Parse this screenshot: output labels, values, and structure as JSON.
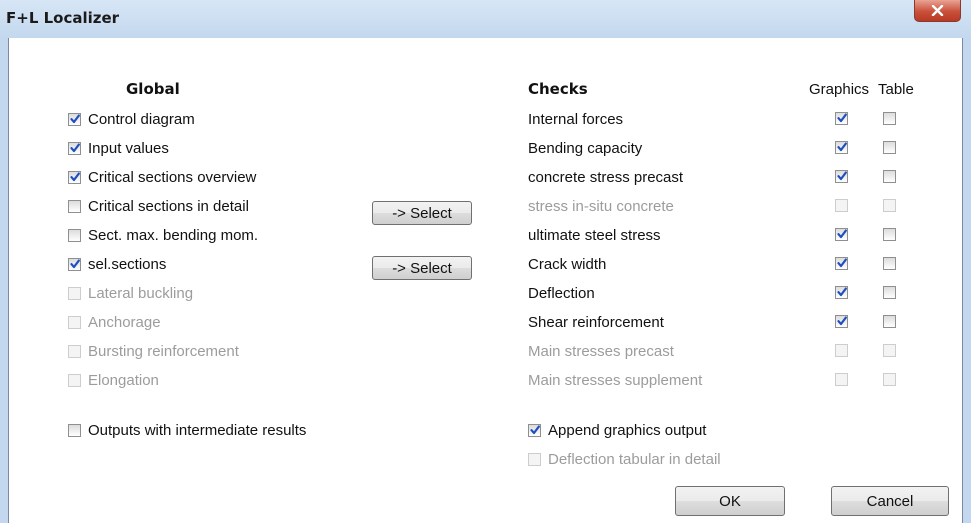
{
  "window": {
    "title": "F+L Localizer",
    "close_glyph": "close-icon"
  },
  "global": {
    "header": "Global",
    "items": [
      {
        "label": "Control diagram",
        "checked": true,
        "enabled": true
      },
      {
        "label": "Input values",
        "checked": true,
        "enabled": true
      },
      {
        "label": "Critical sections overview",
        "checked": true,
        "enabled": true
      },
      {
        "label": "Critical sections in detail",
        "checked": false,
        "enabled": true
      },
      {
        "label": "Sect. max. bending mom.",
        "checked": false,
        "enabled": true
      },
      {
        "label": "sel.sections",
        "checked": true,
        "enabled": true
      },
      {
        "label": "Lateral buckling",
        "checked": false,
        "enabled": false
      },
      {
        "label": "Anchorage",
        "checked": false,
        "enabled": false
      },
      {
        "label": "Bursting reinforcement",
        "checked": false,
        "enabled": false
      },
      {
        "label": "Elongation",
        "checked": false,
        "enabled": false
      }
    ],
    "intermediate": {
      "label": "Outputs with intermediate results",
      "checked": false,
      "enabled": true
    }
  },
  "select_buttons": [
    "-> Select",
    "-> Select"
  ],
  "checks": {
    "header": "Checks",
    "col_graphics": "Graphics",
    "col_table": "Table",
    "items": [
      {
        "label": "Internal forces",
        "enabled": true,
        "graphics": true,
        "table": false
      },
      {
        "label": "Bending capacity",
        "enabled": true,
        "graphics": true,
        "table": false
      },
      {
        "label": "concrete stress precast",
        "enabled": true,
        "graphics": true,
        "table": false
      },
      {
        "label": "stress in-situ concrete",
        "enabled": false,
        "graphics": false,
        "table": false
      },
      {
        "label": "ultimate steel stress",
        "enabled": true,
        "graphics": true,
        "table": false
      },
      {
        "label": "Crack width",
        "enabled": true,
        "graphics": true,
        "table": false
      },
      {
        "label": "Deflection",
        "enabled": true,
        "graphics": true,
        "table": false
      },
      {
        "label": "Shear reinforcement",
        "enabled": true,
        "graphics": true,
        "table": false
      },
      {
        "label": "Main stresses precast",
        "enabled": false,
        "graphics": false,
        "table": false
      },
      {
        "label": "Main stresses supplement",
        "enabled": false,
        "graphics": false,
        "table": false
      }
    ],
    "append_graphics": {
      "label": "Append graphics output",
      "checked": true,
      "enabled": true
    },
    "deflection_tabular": {
      "label": "Deflection tabular in detail",
      "checked": false,
      "enabled": false
    }
  },
  "footer": {
    "ok_label": "OK",
    "cancel_label": "Cancel"
  },
  "colors": {
    "titlebar": "#c3d8ee",
    "check": "#1f4fbf",
    "disabled_text": "#9c9c9c",
    "close_red": "#c9503a"
  }
}
